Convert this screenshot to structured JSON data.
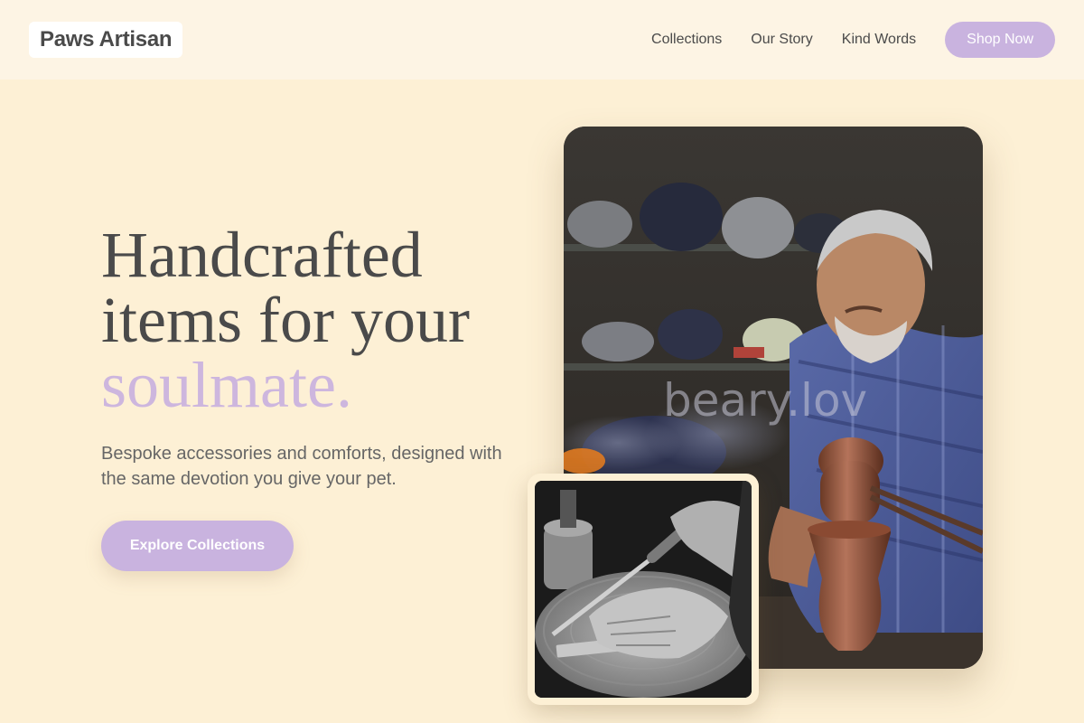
{
  "header": {
    "logo": "Paws Artisan",
    "nav": [
      "Collections",
      "Our Story",
      "Kind Words"
    ],
    "cta_label": "Shop Now"
  },
  "hero": {
    "title_line1": "Handcrafted",
    "title_line2": "items for your",
    "title_accent": "soulmate.",
    "subtitle": "Bespoke accessories and comforts, designed with the same devotion you give your pet.",
    "button_label": "Explore Collections"
  },
  "images": {
    "main_watermark": "beary.lov"
  },
  "colors": {
    "background": "#fdf0d5",
    "header_bg": "#fdf4e4",
    "accent": "#c9b3df",
    "text": "#4a4a4a"
  }
}
